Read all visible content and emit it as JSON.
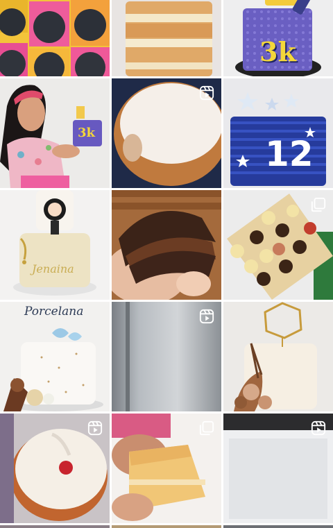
{
  "tiles": [
    {
      "id": "cupcake-liners",
      "type": "image",
      "badge": "none"
    },
    {
      "id": "layered-sponge-cake",
      "type": "image",
      "badge": "none"
    },
    {
      "id": "blue-3k-cake",
      "type": "image",
      "badge": "none",
      "cake_text": "3k"
    },
    {
      "id": "woman-with-3k-cake",
      "type": "image",
      "badge": "none",
      "cake_text": "3k"
    },
    {
      "id": "round-sponge-cake",
      "type": "reel",
      "badge": "reel-icon"
    },
    {
      "id": "blue-12-cake",
      "type": "image",
      "badge": "none",
      "cake_text": "12"
    },
    {
      "id": "jenaina-cake",
      "type": "image",
      "badge": "none",
      "cake_text": "Jenaina"
    },
    {
      "id": "chocolate-cookie-sandwich",
      "type": "image",
      "badge": "none"
    },
    {
      "id": "bonbon-box",
      "type": "carousel",
      "badge": "carousel-icon"
    },
    {
      "id": "porcelana-cake",
      "type": "image",
      "badge": "none",
      "cake_text": "Porcelana"
    },
    {
      "id": "blurry-video",
      "type": "reel",
      "badge": "reel-icon"
    },
    {
      "id": "gold-topper-cake",
      "type": "image",
      "badge": "none"
    },
    {
      "id": "white-cake-berry",
      "type": "reel",
      "badge": "reel-icon"
    },
    {
      "id": "cake-slice-hand",
      "type": "carousel",
      "badge": "carousel-icon"
    },
    {
      "id": "white-box",
      "type": "reel",
      "badge": "reel-icon"
    }
  ],
  "colors": {
    "background": "#ffffff",
    "icon": "#ffffff"
  }
}
